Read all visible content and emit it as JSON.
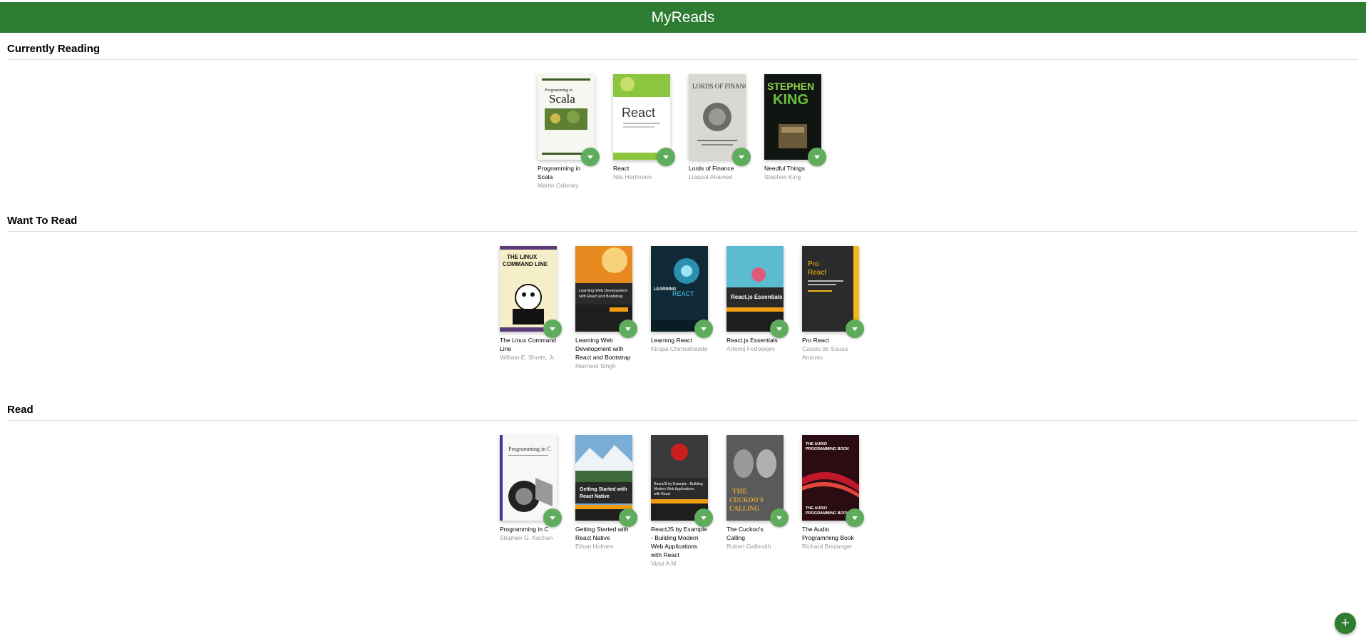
{
  "app": {
    "title": "MyReads"
  },
  "shelves": [
    {
      "title": "Currently Reading",
      "books": [
        {
          "title": "Programming in Scala",
          "authors": "Martin Odersky",
          "cover_icon": "scala-cover"
        },
        {
          "title": "React",
          "authors": "Nils Hartmann",
          "cover_icon": "react-cover"
        },
        {
          "title": "Lords of Finance",
          "authors": "Liaquat Ahamed",
          "cover_icon": "lords-of-finance-cover"
        },
        {
          "title": "Needful Things",
          "authors": "Stephen King",
          "cover_icon": "needful-things-cover"
        }
      ]
    },
    {
      "title": "Want To Read",
      "books": [
        {
          "title": "The Linux Command Line",
          "authors": "William E. Shotts, Jr.",
          "cover_icon": "linux-cover"
        },
        {
          "title": "Learning Web Development with React and Bootstrap",
          "authors": "Harmeet Singh",
          "cover_icon": "learning-web-dev-cover"
        },
        {
          "title": "Learning React",
          "authors": "Kirupa Chinnathambi",
          "cover_icon": "learning-react-cover"
        },
        {
          "title": "React.js Essentials",
          "authors": "Artemij Fedosejev",
          "cover_icon": "reactjs-essentials-cover"
        },
        {
          "title": "Pro React",
          "authors": "Cassio de Sousa Antonio",
          "cover_icon": "pro-react-cover"
        }
      ]
    },
    {
      "title": "Read",
      "books": [
        {
          "title": "Programming in C",
          "authors": "Stephen G. Kochan",
          "cover_icon": "programming-c-cover"
        },
        {
          "title": "Getting Started with React Native",
          "authors": "Ethan Holmes",
          "cover_icon": "react-native-cover"
        },
        {
          "title": "ReactJS by Example - Building Modern Web Applications with React",
          "authors": "Vipul A M",
          "cover_icon": "reactjs-by-example-cover"
        },
        {
          "title": "The Cuckoo's Calling",
          "authors": "Robert Galbraith",
          "cover_icon": "cuckoos-calling-cover"
        },
        {
          "title": "The Audio Programming Book",
          "authors": "Richard Boulanger",
          "cover_icon": "audio-programming-cover"
        }
      ]
    }
  ],
  "add_button": {
    "label": "+",
    "icon": "plus-icon"
  },
  "colors": {
    "header": "#2e7c31",
    "changer": "#60ac5d",
    "add": "#2e7d32"
  }
}
